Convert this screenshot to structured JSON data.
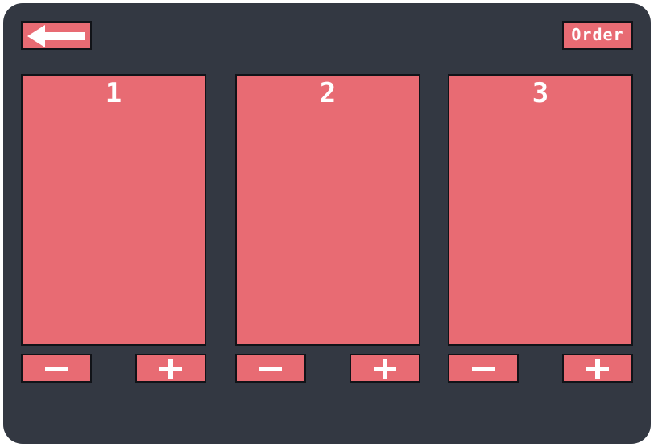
{
  "toolbar": {
    "back_icon": "arrow-left-icon",
    "order_label": "Order"
  },
  "panels": [
    {
      "number": "1",
      "decrement_icon": "minus-icon",
      "increment_icon": "plus-icon"
    },
    {
      "number": "2",
      "decrement_icon": "minus-icon",
      "increment_icon": "plus-icon"
    },
    {
      "number": "3",
      "decrement_icon": "minus-icon",
      "increment_icon": "plus-icon"
    }
  ],
  "colors": {
    "background": "#333842",
    "accent": "#e86b73",
    "border": "#111318",
    "text": "#ffffff"
  }
}
